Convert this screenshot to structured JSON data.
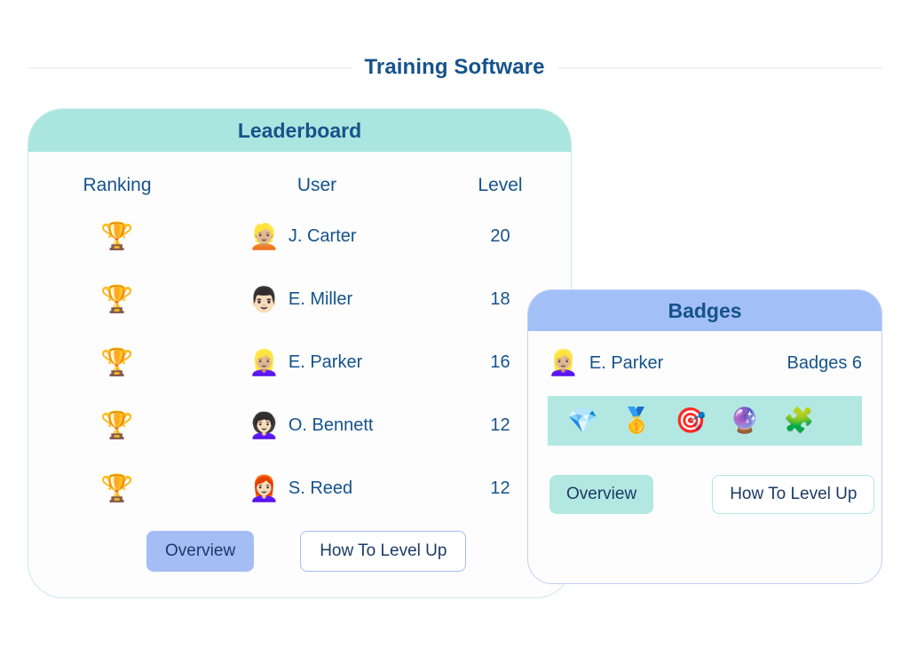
{
  "header": {
    "title": "Training Software"
  },
  "leaderboard": {
    "card_title": "Leaderboard",
    "columns": {
      "ranking": "Ranking",
      "user": "User",
      "level": "Level"
    },
    "rows": [
      {
        "rank_icon": "trophy-icon",
        "rank_glyph": "🏆",
        "avatar_glyph": "👱🏼",
        "avatar_icon": "avatar-blond-man",
        "name": "J. Carter",
        "level": "20"
      },
      {
        "rank_icon": "trophy-icon",
        "rank_glyph": "🏆",
        "avatar_glyph": "👨🏻",
        "avatar_icon": "avatar-mustache-man",
        "name": "E. Miller",
        "level": "18"
      },
      {
        "rank_icon": "trophy-icon",
        "rank_glyph": "🏆",
        "avatar_glyph": "👱🏼‍♀️",
        "avatar_icon": "avatar-blond-woman",
        "name": "E. Parker",
        "level": "16"
      },
      {
        "rank_icon": "trophy-icon",
        "rank_glyph": "🏆",
        "avatar_glyph": "👩🏻‍🦱",
        "avatar_icon": "avatar-dark-hair-woman",
        "name": "O. Bennett",
        "level": "12"
      },
      {
        "rank_icon": "trophy-icon",
        "rank_glyph": "🏆",
        "avatar_glyph": "👩🏻‍🦰",
        "avatar_icon": "avatar-red-hair-woman",
        "name": "S. Reed",
        "level": "12"
      }
    ],
    "buttons": {
      "overview": "Overview",
      "how_to_level_up": "How To Level Up"
    }
  },
  "badges": {
    "card_title": "Badges",
    "user": {
      "avatar_glyph": "👱🏼‍♀️",
      "avatar_icon": "avatar-blond-woman",
      "name": "E. Parker",
      "count_label": "Badges 6"
    },
    "badge_items": [
      {
        "icon": "gem-icon",
        "glyph": "💎"
      },
      {
        "icon": "first-place-medal-icon",
        "glyph": "🥇"
      },
      {
        "icon": "dart-target-icon",
        "glyph": "🎯"
      },
      {
        "icon": "crystal-ball-icon",
        "glyph": "🔮"
      },
      {
        "icon": "puzzle-piece-icon",
        "glyph": "🧩"
      }
    ],
    "buttons": {
      "overview": "Overview",
      "how_to_level_up": "How To Level Up"
    }
  },
  "colors": {
    "title_navy": "#15538c",
    "leaderboard_header_teal": "#abe5e0",
    "badges_header_blue": "#a3bff8",
    "badge_strip_mint": "#b3e8e2",
    "button_blue_fill": "#a5bdf5",
    "card_background": "#fdfdfd",
    "page_background": "#ffffff"
  }
}
